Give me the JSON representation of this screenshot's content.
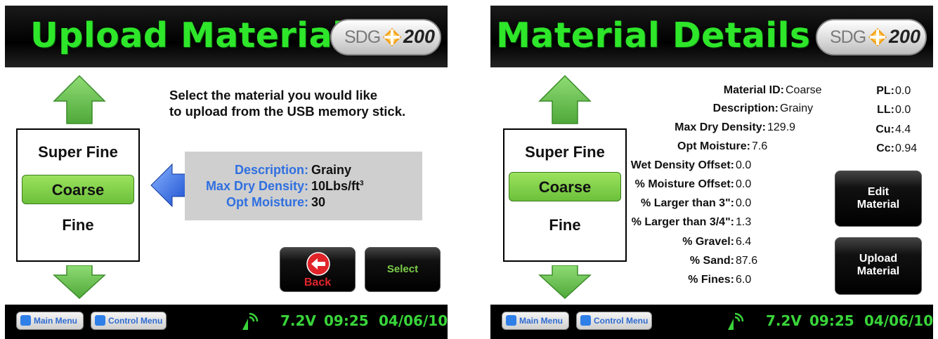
{
  "left": {
    "title": "Upload Material",
    "logo": {
      "brand": "SDG",
      "model": "200"
    },
    "list": [
      "Super Fine",
      "Coarse",
      "Fine"
    ],
    "selected_index": 1,
    "instruction": [
      "Select the material you would like",
      "to upload from the USB memory stick."
    ],
    "info": [
      {
        "label": "Description:",
        "value": "Grainy"
      },
      {
        "label": "Max Dry Density:",
        "value": "10Lbs/ft",
        "sup": "3"
      },
      {
        "label": "Opt Moisture:",
        "value": "30"
      }
    ],
    "back_label": "Back",
    "select_label": "Select"
  },
  "right": {
    "title": "Material Details",
    "logo": {
      "brand": "SDG",
      "model": "200"
    },
    "list": [
      "Super Fine",
      "Coarse",
      "Fine"
    ],
    "selected_index": 1,
    "details": [
      {
        "label": "Material ID:",
        "value": "Coarse"
      },
      {
        "label": "Description:",
        "value": "Grainy"
      },
      {
        "label": "Max Dry Density:",
        "value": "129.9"
      },
      {
        "label": "Opt Moisture:",
        "value": "7.6"
      },
      {
        "label": "Wet Density Offset:",
        "value": "0.0"
      },
      {
        "label": "% Moisture Offset:",
        "value": "0.0"
      },
      {
        "label": "% Larger than 3\":",
        "value": "0.0"
      },
      {
        "label": "% Larger than 3/4\":",
        "value": "1.3"
      },
      {
        "label": "% Gravel:",
        "value": "6.4"
      },
      {
        "label": "% Sand:",
        "value": "87.6"
      },
      {
        "label": "% Fines:",
        "value": "6.0"
      }
    ],
    "limits": [
      {
        "label": "PL:",
        "value": "0.0"
      },
      {
        "label": "LL:",
        "value": "0.0"
      },
      {
        "label": "Cu:",
        "value": "4.4"
      },
      {
        "label": "Cc:",
        "value": "0.94"
      }
    ],
    "edit_label": [
      "Edit",
      "Material"
    ],
    "upload_label": [
      "Upload",
      "Material"
    ]
  },
  "footer": {
    "main_menu": "Main Menu",
    "control_menu": "Control Menu",
    "voltage": "7.2V",
    "time": "09:25",
    "date": "04/06/10"
  },
  "colors": {
    "title_green": "#2ee62a",
    "label_blue": "#2f6fe0",
    "select_green": "#7ccd48",
    "back_red": "#e0242a"
  }
}
